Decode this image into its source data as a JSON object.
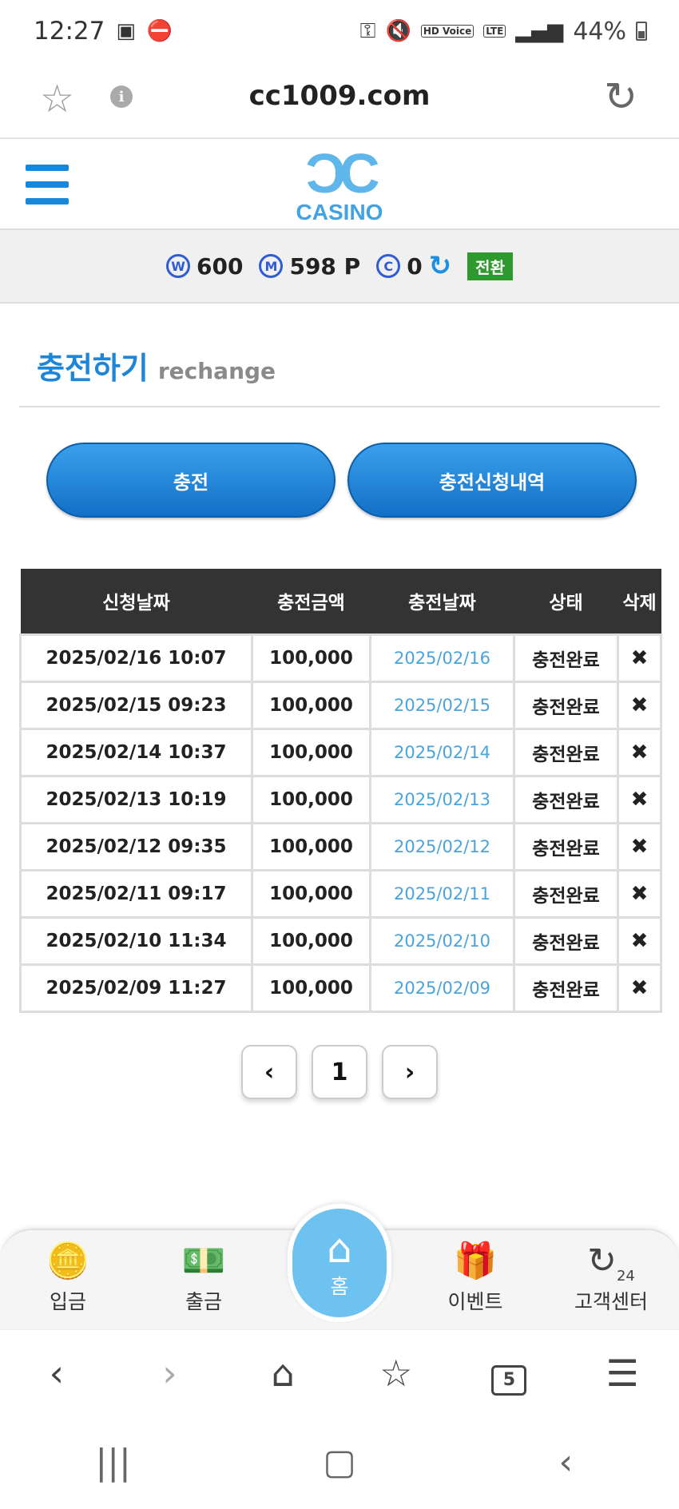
{
  "status_bar": {
    "time": "12:27",
    "network": "LTE",
    "hd_voice": "HD Voice",
    "battery": "44%"
  },
  "browser": {
    "url": "cc1009.com"
  },
  "site": {
    "logo_text": "CASINO"
  },
  "balances": {
    "w_label": "W",
    "w_value": "600",
    "m_label": "M",
    "m_value": "598 P",
    "c_label": "C",
    "c_value": "0",
    "switch_label": "전환"
  },
  "page": {
    "title_ko": "충전하기",
    "title_en": "rechange"
  },
  "buttons": {
    "charge": "충전",
    "history": "충전신청내역"
  },
  "table": {
    "headers": [
      "신청날짜",
      "충전금액",
      "충전날짜",
      "상태",
      "삭제"
    ],
    "rows": [
      {
        "request_date": "2025/02/16 10:07",
        "amount": "100,000",
        "charge_date": "2025/02/16",
        "status": "충전완료",
        "delete": "✖"
      },
      {
        "request_date": "2025/02/15 09:23",
        "amount": "100,000",
        "charge_date": "2025/02/15",
        "status": "충전완료",
        "delete": "✖"
      },
      {
        "request_date": "2025/02/14 10:37",
        "amount": "100,000",
        "charge_date": "2025/02/14",
        "status": "충전완료",
        "delete": "✖"
      },
      {
        "request_date": "2025/02/13 10:19",
        "amount": "100,000",
        "charge_date": "2025/02/13",
        "status": "충전완료",
        "delete": "✖"
      },
      {
        "request_date": "2025/02/12 09:35",
        "amount": "100,000",
        "charge_date": "2025/02/12",
        "status": "충전완료",
        "delete": "✖"
      },
      {
        "request_date": "2025/02/11 09:17",
        "amount": "100,000",
        "charge_date": "2025/02/11",
        "status": "충전완료",
        "delete": "✖"
      },
      {
        "request_date": "2025/02/10 11:34",
        "amount": "100,000",
        "charge_date": "2025/02/10",
        "status": "충전완료",
        "delete": "✖"
      },
      {
        "request_date": "2025/02/09 11:27",
        "amount": "100,000",
        "charge_date": "2025/02/09",
        "status": "충전완료",
        "delete": "✖"
      }
    ]
  },
  "pagination": {
    "prev": "‹",
    "current": "1",
    "next": "›"
  },
  "site_nav": {
    "deposit": "입금",
    "withdraw": "출금",
    "home": "홈",
    "event": "이벤트",
    "support": "고객센터",
    "support_badge": "24"
  },
  "browser_nav": {
    "tab_count": "5"
  },
  "colors": {
    "accent": "#1d86d8",
    "header_bg": "#333333",
    "date_link": "#4aa3dc",
    "switch": "#2e9a2e"
  }
}
